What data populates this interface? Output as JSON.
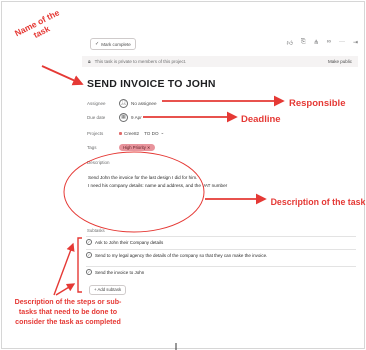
{
  "toolbar": {
    "mark_complete": "Mark complete",
    "icons": [
      "thumbs-up-icon",
      "attachment-icon",
      "subtask-icon",
      "link-icon",
      "more-icon",
      "close-panel-icon"
    ]
  },
  "privacy_bar": {
    "text": "This task is private to members of this project.",
    "action": "Make public"
  },
  "task": {
    "title": "SEND INVOICE TO JOHN",
    "fields": {
      "assignee_label": "Assignee",
      "assignee_value": "No assignee",
      "due_label": "Due date",
      "due_value": "9 Apr",
      "projects_label": "Projects",
      "project_name": "Cree82",
      "project_section": "TO DO",
      "tags_label": "Tags",
      "tag_value": "High Priority",
      "description_label": "Description"
    },
    "description_lines": [
      "Send John the invoice for the last design I did for him.",
      "I need his company details: name and address, and the VAT number"
    ],
    "subtasks_label": "Subtasks",
    "subtasks": [
      "Ask to John their Company details",
      "Send to my legal agency the details of the company so that they can make the invoice.",
      "Send the invoice to John"
    ],
    "add_subtask": "+ Add subtask"
  },
  "annotations": {
    "name_of_task": "Name of the task",
    "responsible": "Responsible",
    "deadline": "Deadline",
    "description": "Description of the task",
    "steps": "Description of the steps or sub-tasks that need to be done to consider the task as completed"
  },
  "colors": {
    "annotation": "#e53935",
    "tag_bg": "#e8949c"
  }
}
